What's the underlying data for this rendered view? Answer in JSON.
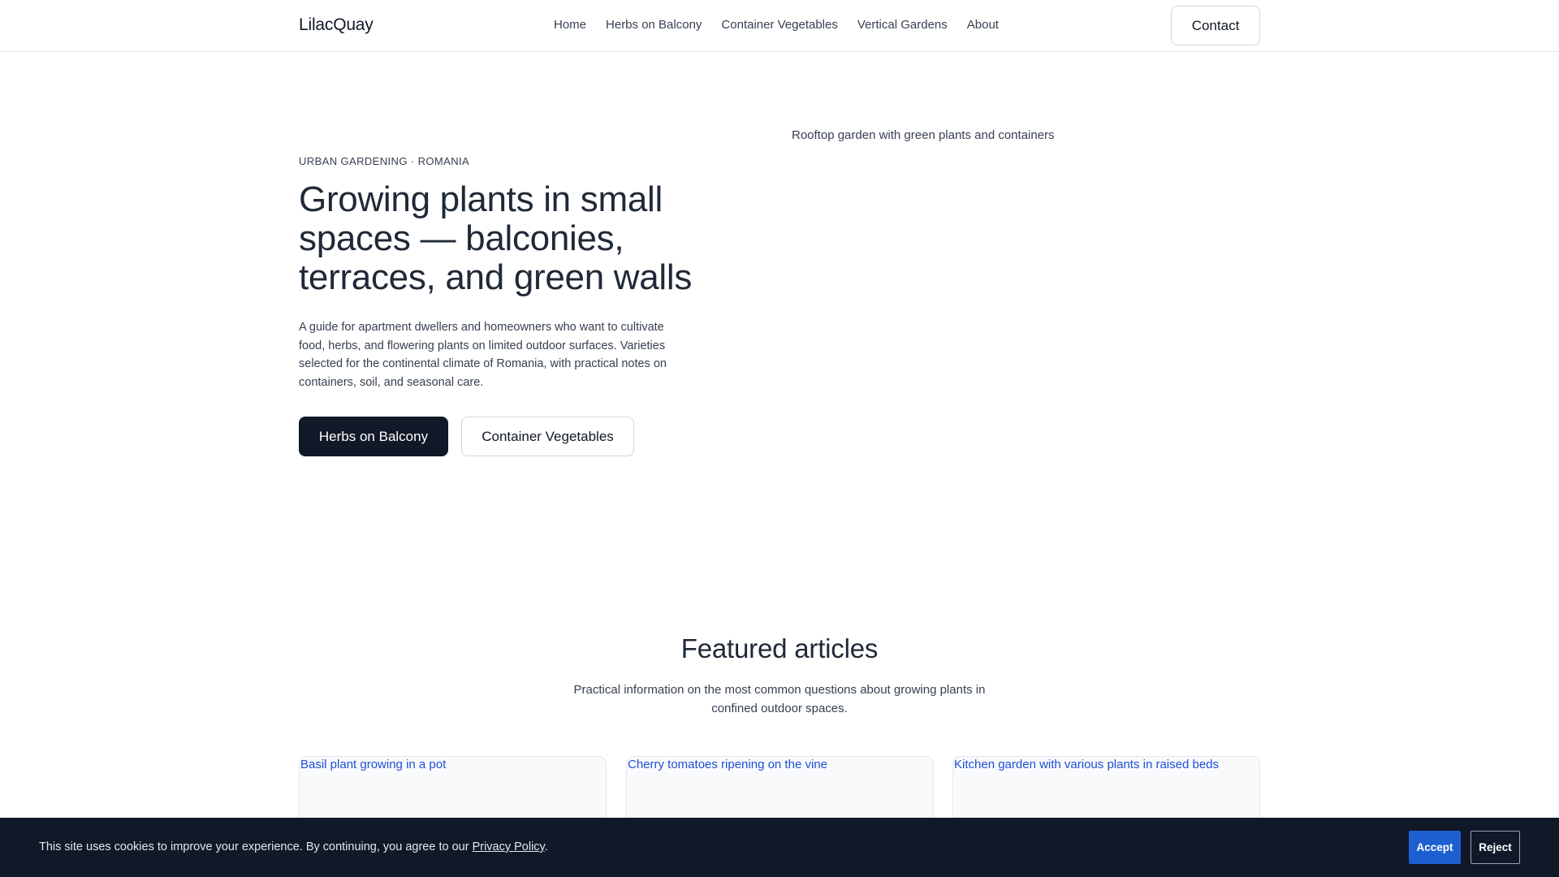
{
  "header": {
    "brand": "LilacQuay",
    "nav": [
      "Home",
      "Herbs on Balcony",
      "Container Vegetables",
      "Vertical Gardens",
      "About"
    ],
    "contact_label": "Contact"
  },
  "hero": {
    "eyebrow": "URBAN GARDENING · ROMANIA",
    "title": "Growing plants in small spaces — balconies, terraces, and green walls",
    "description": "A guide for apartment dwellers and homeowners who want to cultivate food, herbs, and flowering plants on limited outdoor surfaces. Varieties selected for the continental climate of Romania, with practical notes on containers, soil, and seasonal care.",
    "primary_button": "Herbs on Balcony",
    "secondary_button": "Container Vegetables",
    "image_alt": "Rooftop garden with green plants and containers"
  },
  "featured": {
    "title": "Featured articles",
    "subtitle": "Practical information on the most common questions about growing plants in confined outdoor spaces.",
    "cards": [
      {
        "image_alt": "Basil plant growing in a pot"
      },
      {
        "image_alt": "Cherry tomatoes ripening on the vine"
      },
      {
        "image_alt": "Kitchen garden with various plants in raised beds"
      }
    ]
  },
  "cookie": {
    "text": "This site uses cookies to improve your experience. By continuing, you agree to our ",
    "link": "Privacy Policy",
    "after": ".",
    "accept": "Accept",
    "reject": "Reject"
  },
  "colors": {
    "primary_dark": "#111827",
    "accept_blue": "#1d5fd1",
    "link_blue": "#1d4ed8",
    "border": "#e5e7eb"
  }
}
